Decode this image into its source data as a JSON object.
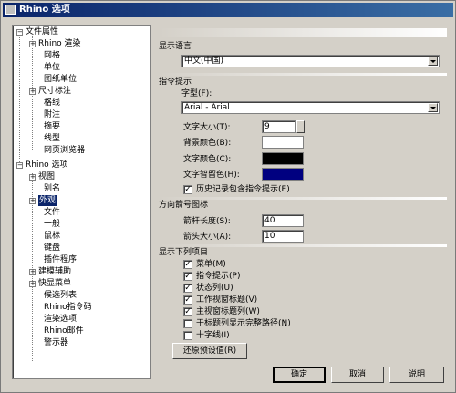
{
  "window": {
    "title": "Rhino 选项"
  },
  "tree": {
    "items": [
      {
        "label": "文件属性"
      },
      {
        "label": "Rhino 渲染"
      },
      {
        "label": "网格"
      },
      {
        "label": "单位"
      },
      {
        "label": "图纸单位"
      },
      {
        "label": "尺寸标注"
      },
      {
        "label": "格线"
      },
      {
        "label": "附注"
      },
      {
        "label": "摘要"
      },
      {
        "label": "线型"
      },
      {
        "label": "网页浏览器"
      },
      {
        "label": "Rhino 选项"
      },
      {
        "label": "视图"
      },
      {
        "label": "别名"
      },
      {
        "label": "外观"
      },
      {
        "label": "文件"
      },
      {
        "label": "一般"
      },
      {
        "label": "鼠标"
      },
      {
        "label": "键盘"
      },
      {
        "label": "插件程序"
      },
      {
        "label": "建模辅助"
      },
      {
        "label": "快显菜单"
      },
      {
        "label": "候选列表"
      },
      {
        "label": "Rhino指令码"
      },
      {
        "label": "渲染选项"
      },
      {
        "label": "Rhino邮件"
      },
      {
        "label": "警示器"
      }
    ]
  },
  "panel": {
    "language": {
      "section": "显示语言",
      "value": "中文(中国)"
    },
    "command_prompt": {
      "section": "指令提示",
      "font_label": "字型(F):",
      "font_value": "Arial - Arial",
      "text_size_label": "文字大小(T):",
      "text_size_value": "9",
      "bg_color_label": "背景颜色(B):",
      "text_color_label": "文字颜色(C):",
      "hover_color_label": "文字智留色(H):",
      "history_label": "历史记录包含指令提示(E)",
      "history_checked": true,
      "colors": {
        "background": "#ffffff",
        "text": "#000000",
        "hover": "#000080"
      }
    },
    "arrow": {
      "section": "方向箭号图标",
      "shaft_label": "箭杆长度(S):",
      "shaft_value": "40",
      "head_label": "箭头大小(A):",
      "head_value": "10"
    },
    "show_items": {
      "section": "显示下列项目",
      "items": [
        {
          "label": "菜单(M)",
          "checked": true
        },
        {
          "label": "指令提示(P)",
          "checked": true
        },
        {
          "label": "状态列(U)",
          "checked": true
        },
        {
          "label": "工作视窗标题(V)",
          "checked": true
        },
        {
          "label": "主视窗标题列(W)",
          "checked": true
        },
        {
          "label": "于标题列显示完整路径(N)",
          "checked": false
        },
        {
          "label": "十字线(I)",
          "checked": false
        }
      ]
    },
    "restore_label": "还原预设值(R)"
  },
  "footer": {
    "ok_label": "确定",
    "cancel_label": "取消",
    "help_label": "说明"
  }
}
